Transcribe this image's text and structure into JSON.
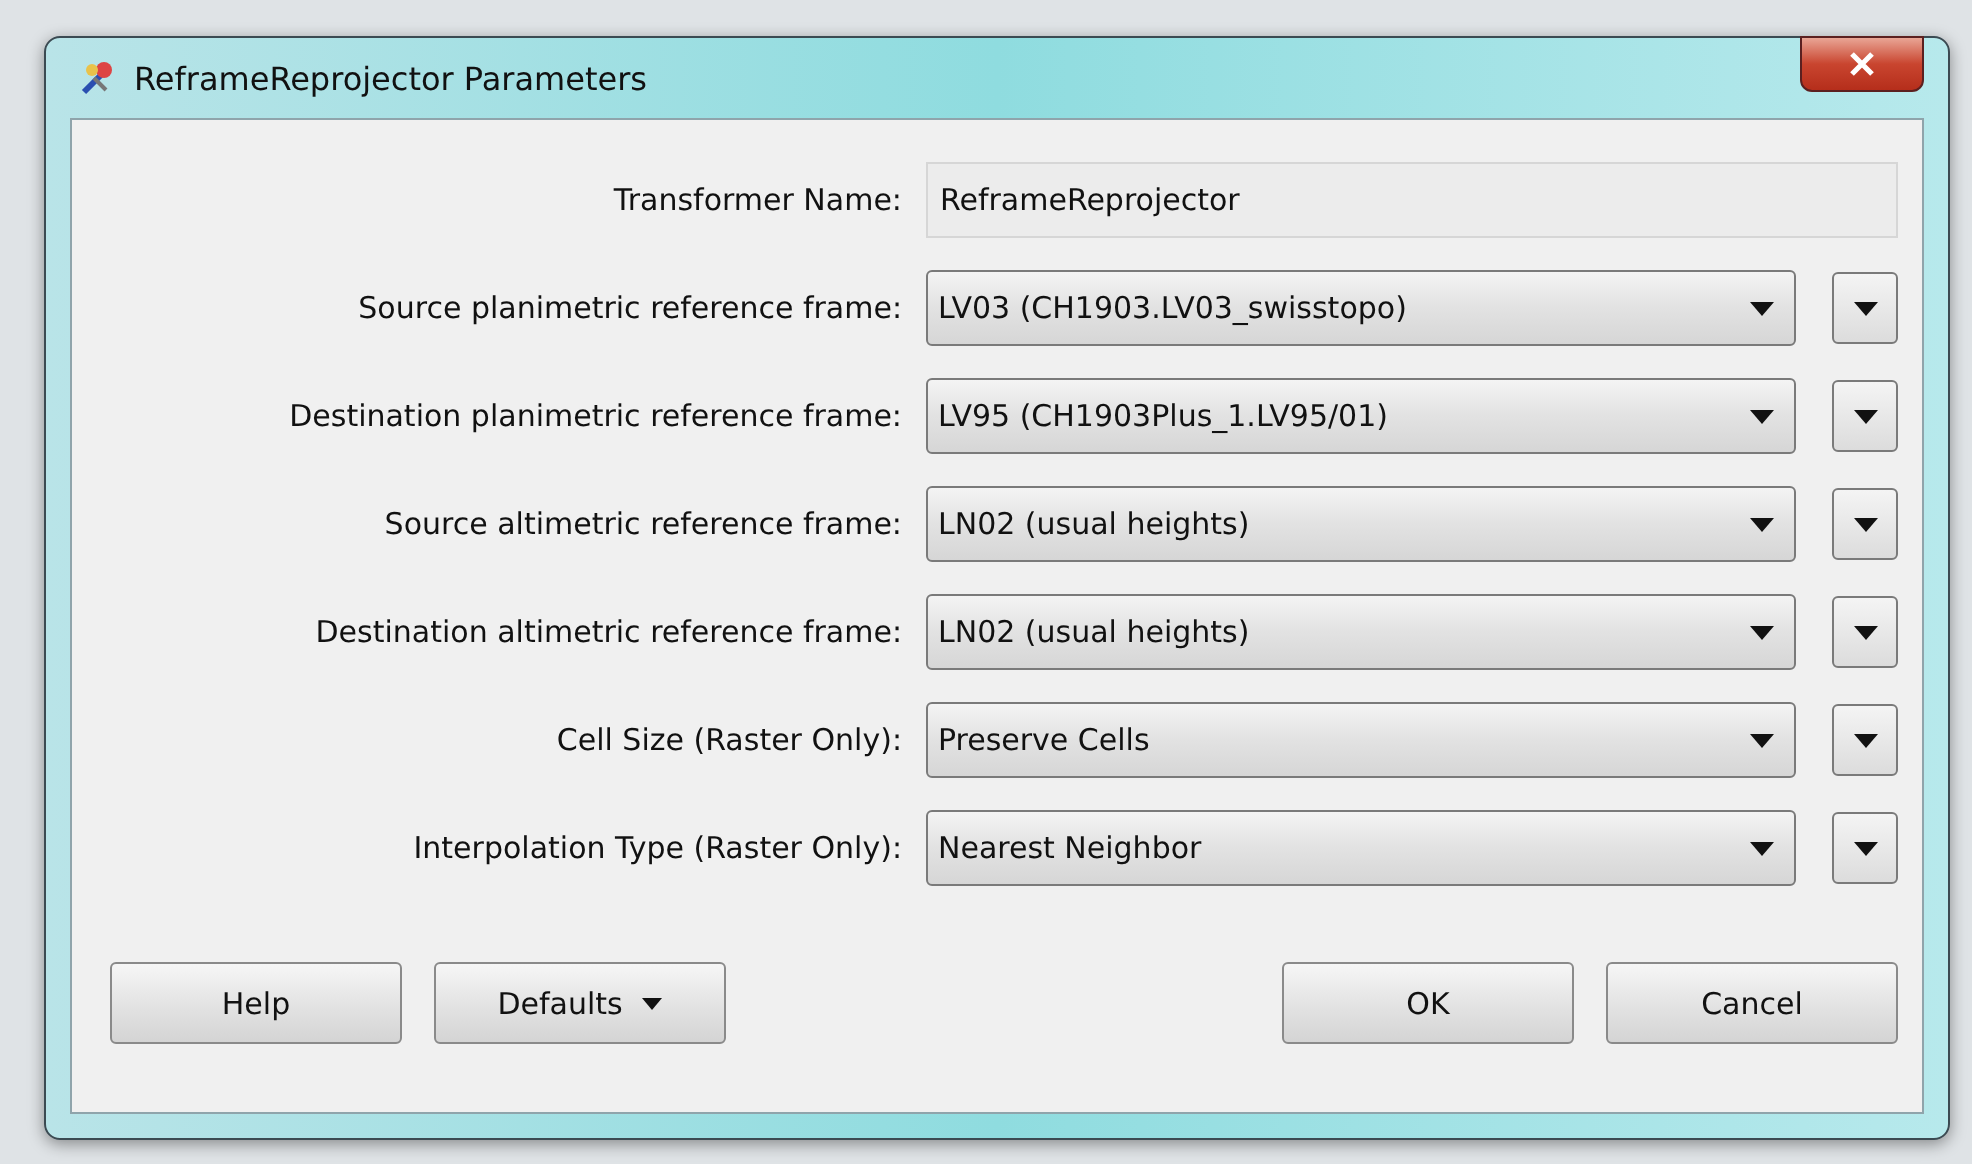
{
  "window": {
    "title": "ReframeReprojector Parameters"
  },
  "transformer_name": {
    "label": "Transformer Name:",
    "value": "ReframeReprojector"
  },
  "parameters": [
    {
      "label": "Source planimetric reference frame:",
      "value": "LV03 (CH1903.LV03_swisstopo)"
    },
    {
      "label": "Destination planimetric reference frame:",
      "value": "LV95 (CH1903Plus_1.LV95/01)"
    },
    {
      "label": "Source altimetric reference frame:",
      "value": "LN02 (usual heights)"
    },
    {
      "label": "Destination altimetric reference frame:",
      "value": "LN02 (usual heights)"
    },
    {
      "label": "Cell Size (Raster Only):",
      "value": "Preserve Cells"
    },
    {
      "label": "Interpolation Type (Raster Only):",
      "value": "Nearest Neighbor"
    }
  ],
  "buttons_left": [
    {
      "label": "Help",
      "kind": "plain"
    },
    {
      "label": "Defaults",
      "kind": "menu"
    }
  ],
  "buttons_right": [
    {
      "label": "OK",
      "kind": "plain"
    },
    {
      "label": "Cancel",
      "kind": "plain"
    }
  ]
}
